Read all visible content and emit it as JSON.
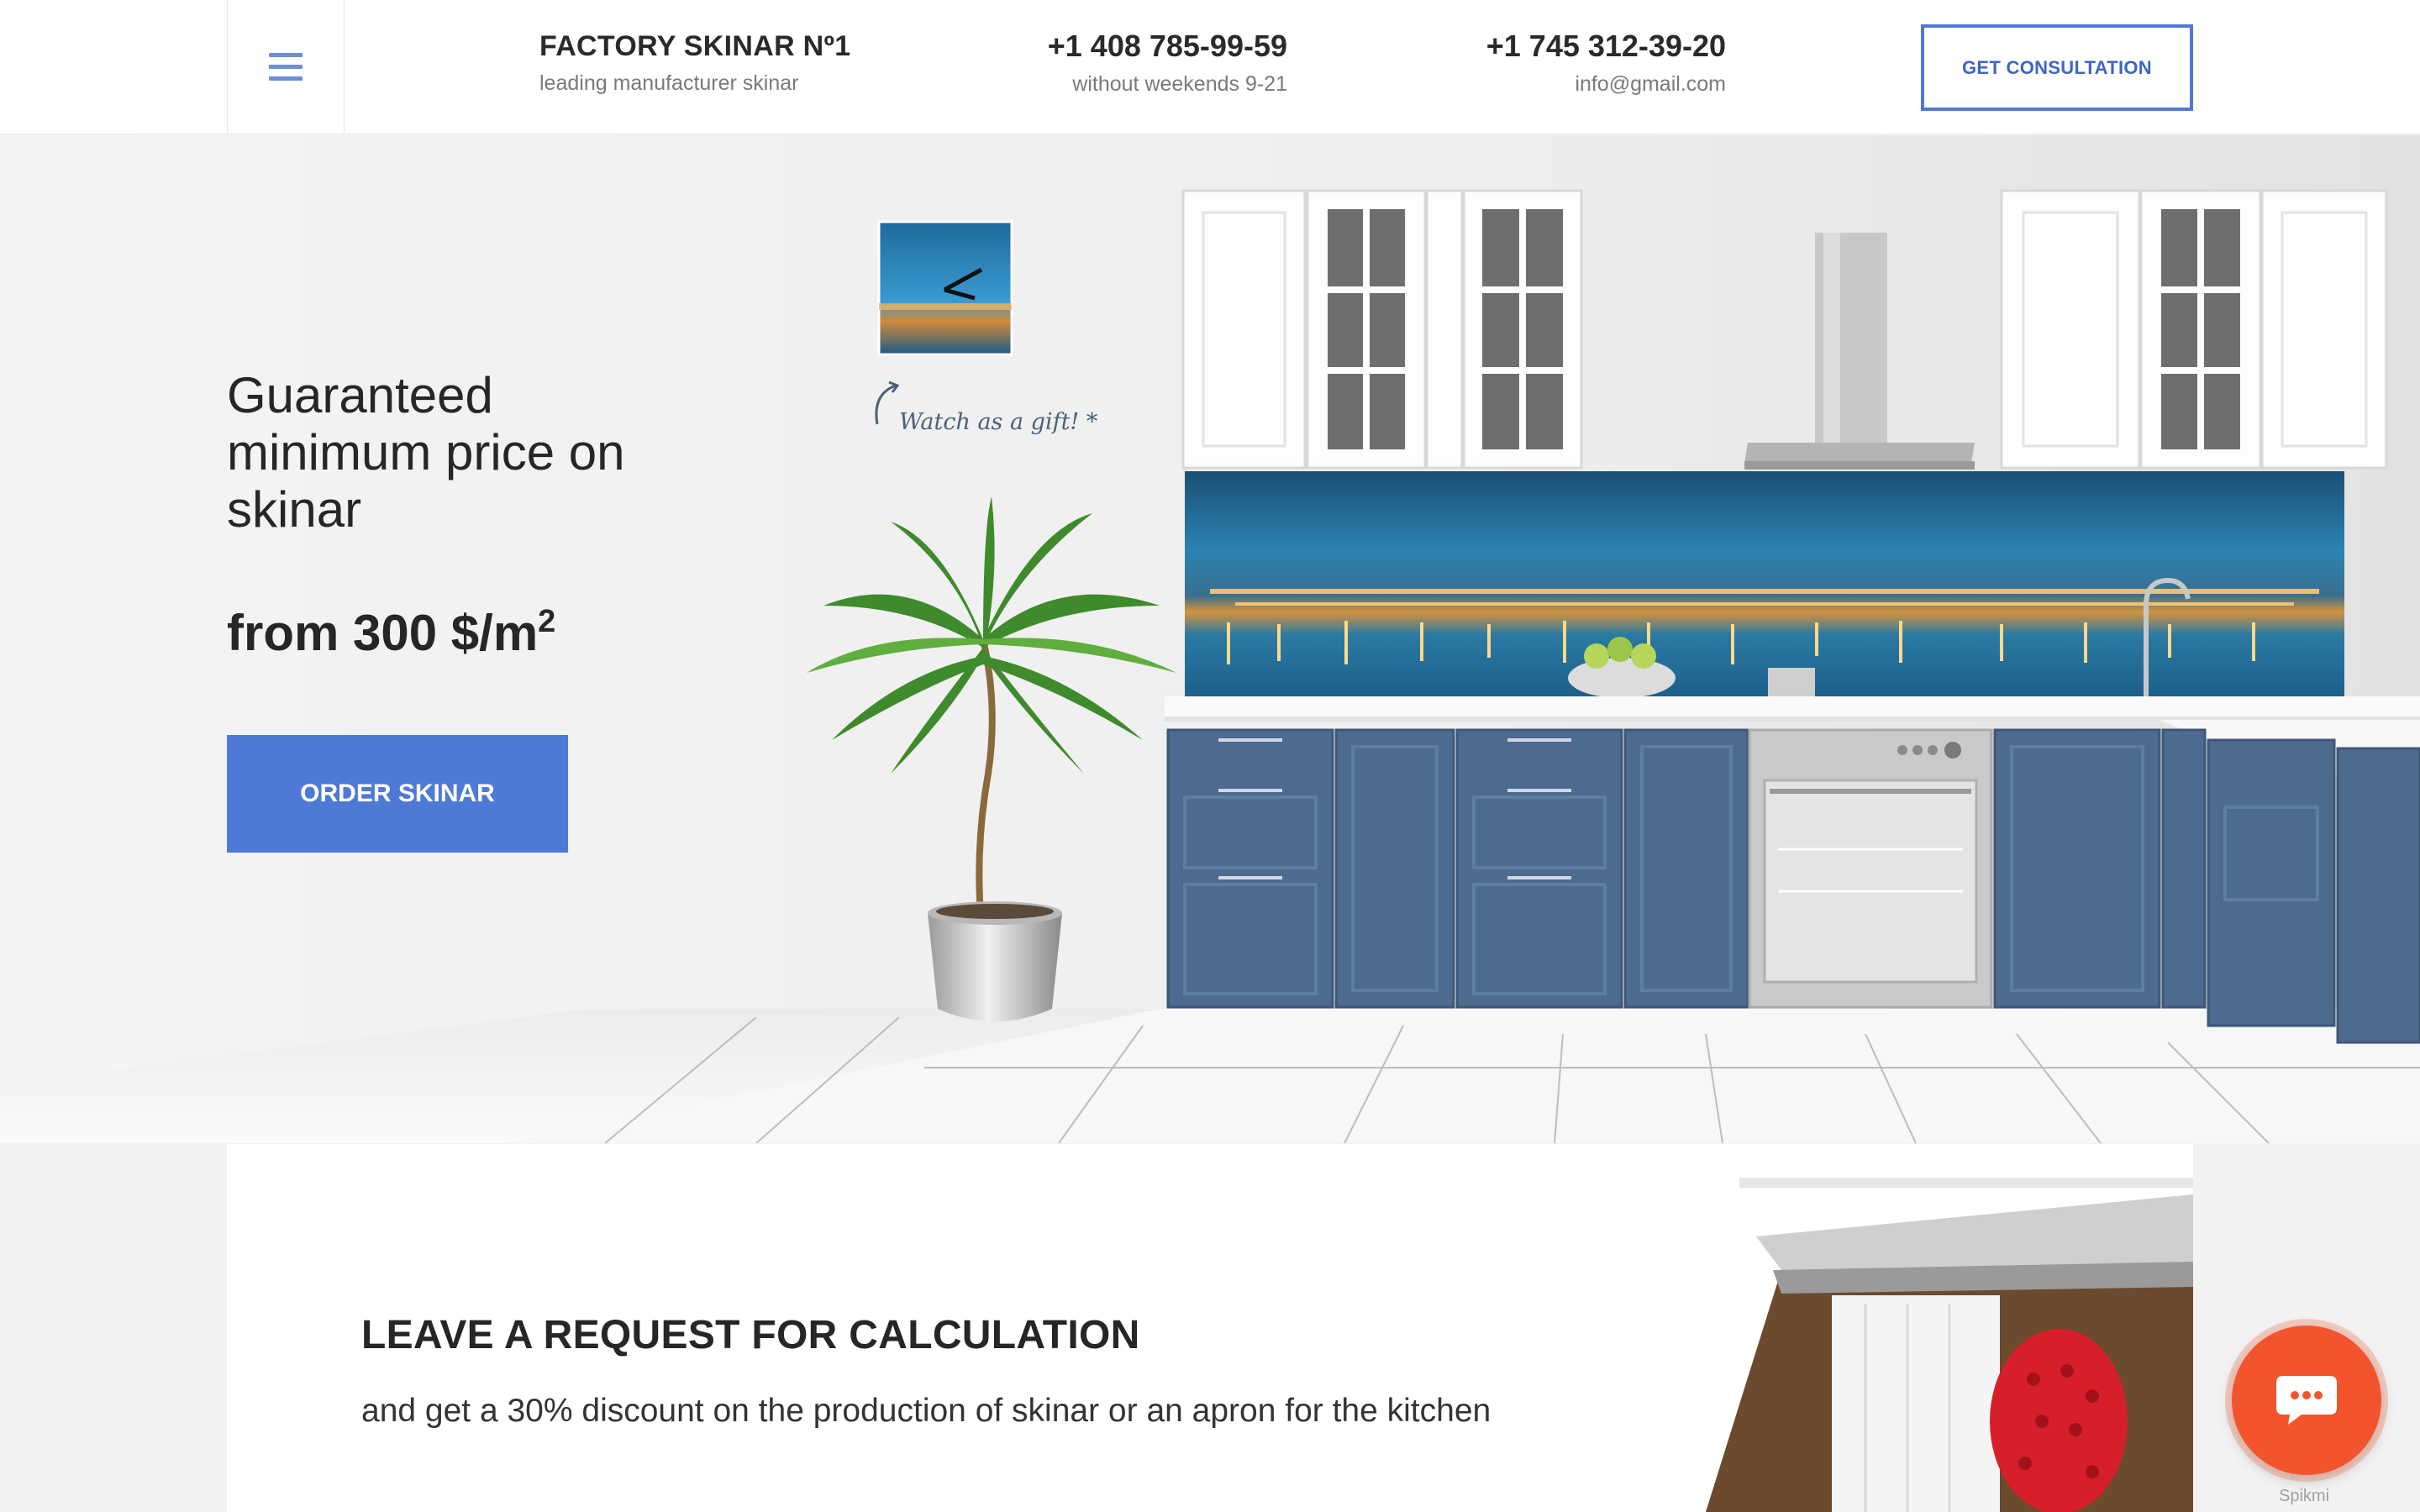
{
  "header": {
    "brand_title": "FACTORY SKINAR Nº1",
    "brand_subtitle": "leading manufacturer skinar",
    "phone_1": "+1 408 785-99-59",
    "phone_1_note": "without weekends 9-21",
    "phone_2": "+1 745 312-39-20",
    "email": "info@gmail.com",
    "consult_button": "GET CONSULTATION",
    "menu_icon": "hamburger-menu-icon"
  },
  "hero": {
    "title": "Guaranteed minimum price on skinar",
    "price_prefix": "from 300 $/m",
    "price_unit_power": "2",
    "order_button": "ORDER SKINAR",
    "gift_label": "Watch as a gift! *"
  },
  "request": {
    "title": "LEAVE A REQUEST FOR CALCULATION",
    "subtitle": "and get a 30% discount on the production of skinar or an apron for the kitchen"
  },
  "chat": {
    "icon": "chat-bubble-icon",
    "brand": "Spikmi"
  },
  "colors": {
    "accent": "#4e79d6",
    "chat": "#f2542d",
    "cabinet_blue": "#4d6a8f"
  }
}
